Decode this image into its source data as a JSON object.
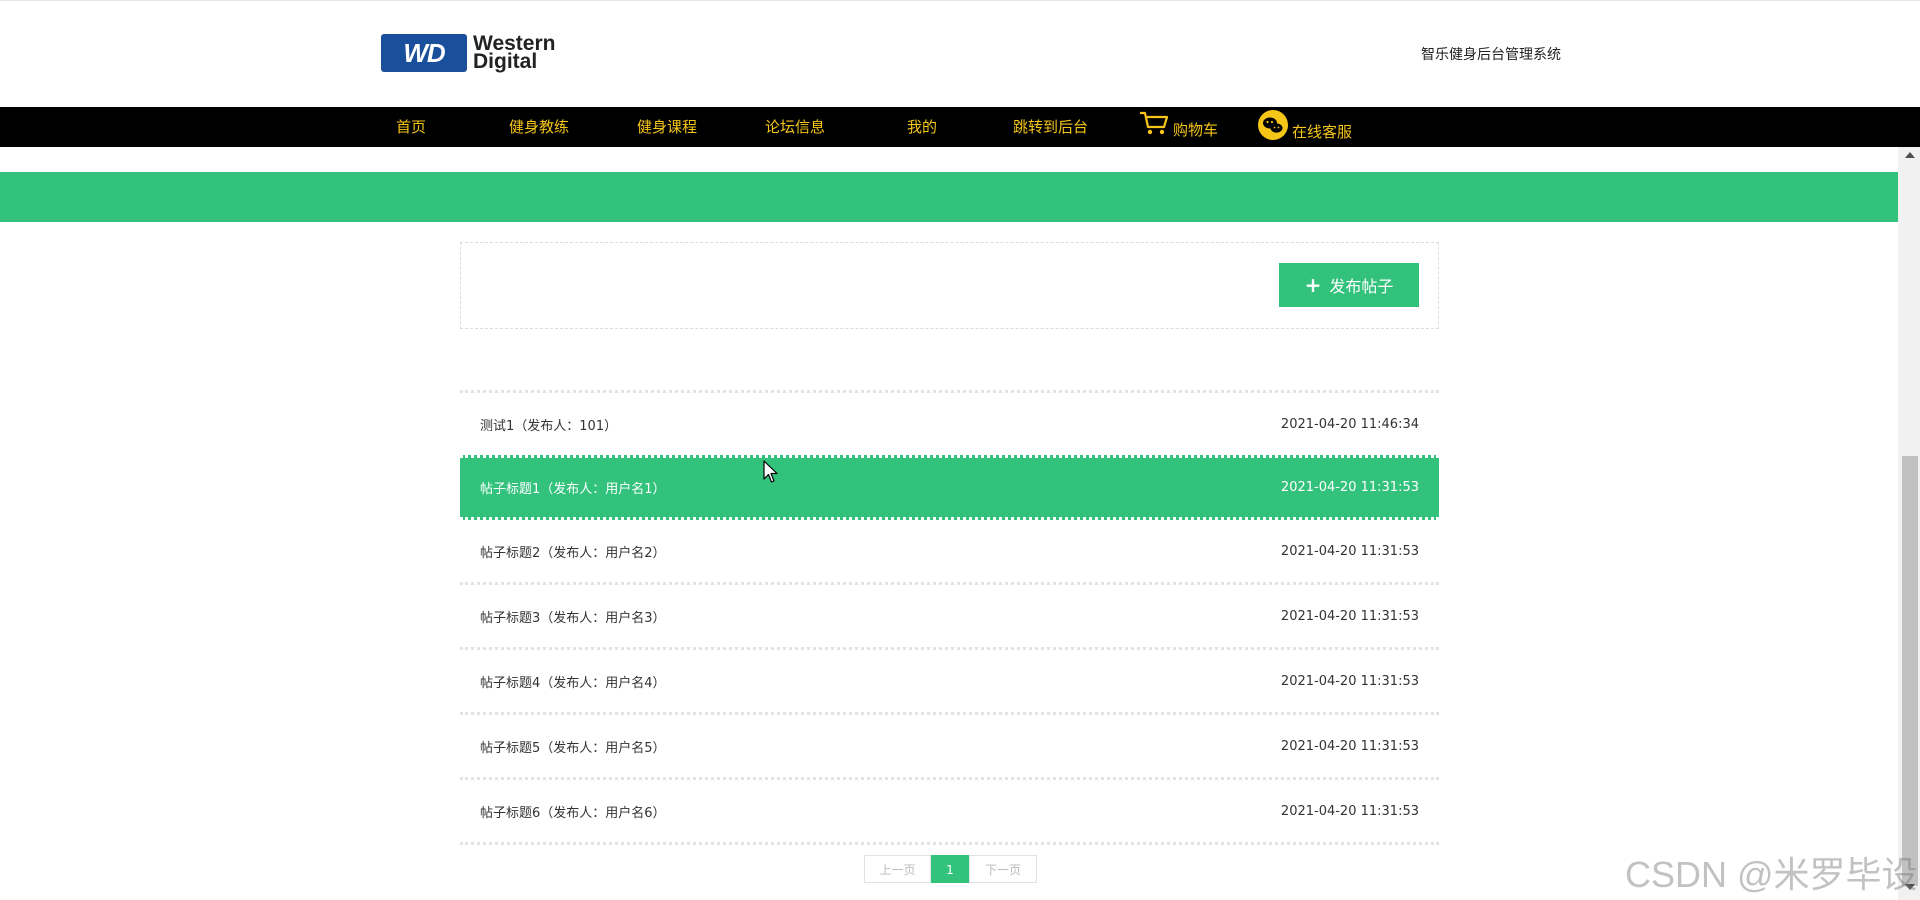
{
  "header": {
    "logo_line1": "Western",
    "logo_line2": "Digital",
    "logo_badge": "WD",
    "system_name": "智乐健身后台管理系统"
  },
  "nav": {
    "items": [
      {
        "label": "首页"
      },
      {
        "label": "健身教练"
      },
      {
        "label": "健身课程"
      },
      {
        "label": "论坛信息"
      },
      {
        "label": "我的"
      },
      {
        "label": "跳转到后台"
      },
      {
        "label": "购物车",
        "icon": "cart-icon"
      },
      {
        "label": "在线客服",
        "icon": "wechat-icon"
      }
    ]
  },
  "actions": {
    "post_button": "发布帖子",
    "post_button_icon": "plus-icon"
  },
  "posts": [
    {
      "title": "测试1（发布人：101）",
      "time": "2021-04-20 11:46:34",
      "active": false
    },
    {
      "title": "帖子标题1（发布人：用户名1）",
      "time": "2021-04-20 11:31:53",
      "active": true
    },
    {
      "title": "帖子标题2（发布人：用户名2）",
      "time": "2021-04-20 11:31:53",
      "active": false
    },
    {
      "title": "帖子标题3（发布人：用户名3）",
      "time": "2021-04-20 11:31:53",
      "active": false
    },
    {
      "title": "帖子标题4（发布人：用户名4）",
      "time": "2021-04-20 11:31:53",
      "active": false
    },
    {
      "title": "帖子标题5（发布人：用户名5）",
      "time": "2021-04-20 11:31:53",
      "active": false
    },
    {
      "title": "帖子标题6（发布人：用户名6）",
      "time": "2021-04-20 11:31:53",
      "active": false
    }
  ],
  "pagination": {
    "prev": "上一页",
    "current": "1",
    "next": "下一页"
  },
  "watermark": "CSDN @米罗毕设",
  "colors": {
    "accent": "#32c27c",
    "nav_bg": "#000000",
    "nav_text": "#f5c518"
  }
}
